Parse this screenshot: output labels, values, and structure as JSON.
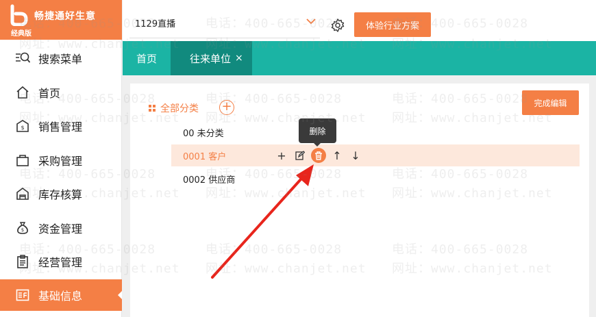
{
  "app": {
    "logo_title": "畅捷通好生意",
    "logo_sub": "经典版",
    "brand_color": "#f47f45",
    "teal_color": "#1bb4a4"
  },
  "sidebar": {
    "items": [
      {
        "label": "搜索菜单",
        "icon": "search-menu-icon"
      },
      {
        "label": "首页",
        "icon": "home-icon"
      },
      {
        "label": "销售管理",
        "icon": "sales-icon"
      },
      {
        "label": "采购管理",
        "icon": "purchase-icon"
      },
      {
        "label": "库存核算",
        "icon": "warehouse-icon"
      },
      {
        "label": "资金管理",
        "icon": "money-bag-icon"
      },
      {
        "label": "经营管理",
        "icon": "clipboard-icon"
      },
      {
        "label": "基础信息",
        "icon": "info-card-icon",
        "active": true
      }
    ]
  },
  "topbar": {
    "company": "1129直播",
    "promo_label": "体验行业方案"
  },
  "tabs": [
    {
      "label": "首页"
    },
    {
      "label": "往来单位",
      "close": "×",
      "active": true
    }
  ],
  "panel": {
    "finish_label": "完成编辑",
    "all_category_label": "全部分类",
    "add_symbol": "+",
    "rows": [
      {
        "label": "00 未分类"
      },
      {
        "label": "0001 客户",
        "selected": true
      },
      {
        "label": "0002 供应商"
      }
    ],
    "actions": {
      "add": "+",
      "up": "↑",
      "down": "↓"
    },
    "tooltip": "删除"
  },
  "watermark": {
    "phone": "电话：400-665-0028",
    "site": "网址：www.chanjet.net"
  }
}
